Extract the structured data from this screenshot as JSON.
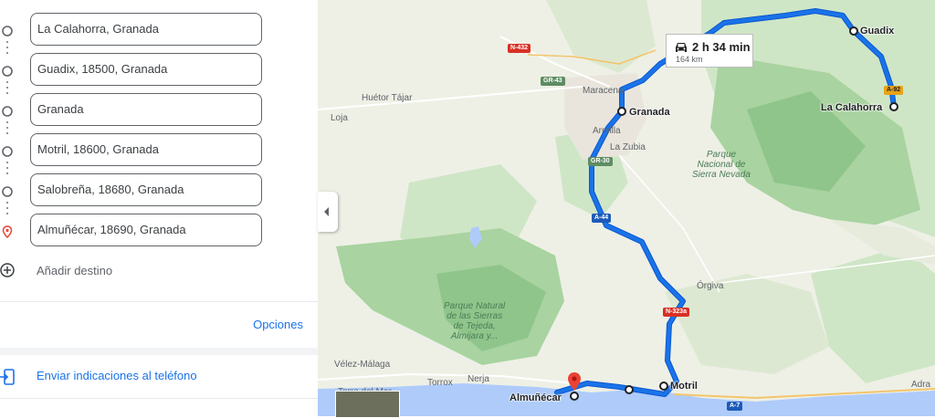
{
  "panel": {
    "waypoints": [
      {
        "label": "La Calahorra, Granada",
        "icon": "circle-icon"
      },
      {
        "label": "Guadix, 18500, Granada",
        "icon": "circle-icon"
      },
      {
        "label": "Granada",
        "icon": "circle-icon"
      },
      {
        "label": "Motril, 18600, Granada",
        "icon": "circle-icon"
      },
      {
        "label": "Salobreña, 18680, Granada",
        "icon": "circle-icon"
      },
      {
        "label": "Almuñécar, 18690, Granada",
        "icon": "destination-pin-icon"
      }
    ],
    "add_destination": "Añadir destino",
    "options": "Opciones",
    "send_directions": "Enviar indicaciones al teléfono"
  },
  "map": {
    "route_info": {
      "duration": "2 h 34 min",
      "distance": "164 km"
    },
    "cities": {
      "guadix": "Guadix",
      "granada": "Granada",
      "la_calahorra": "La Calahorra",
      "motril": "Motril",
      "almunecar": "Almuñécar"
    },
    "places": {
      "huetor_tajar": "Huétor Tájar",
      "loja": "Loja",
      "maracena": "Maracena",
      "armilla": "Armilla",
      "la_zubia": "La Zubia",
      "orgiva": "Órgiva",
      "velez_malaga": "Vélez-Málaga",
      "torrox": "Torrox",
      "nerja": "Nerja",
      "adra": "Adra",
      "torre_del_mar": "Torre del Mar"
    },
    "parks": {
      "sierra_nevada": "Parque\nNacional de\nSierra Nevada",
      "tejeda": "Parque Natural\nde las Sierras\nde Tejeda,\nAlmijara y..."
    },
    "roads": {
      "n432": "N-432",
      "gr43": "GR-43",
      "gr30": "GR-30",
      "a44": "A-44",
      "n323a": "N-323a",
      "a92": "A-92",
      "a7": "A-7"
    },
    "colors": {
      "route": "#1a73e8",
      "route_outline": "#0b57d0",
      "park": "#9fcf9a",
      "water": "#aecbfa",
      "pin": "#ea4335"
    }
  }
}
